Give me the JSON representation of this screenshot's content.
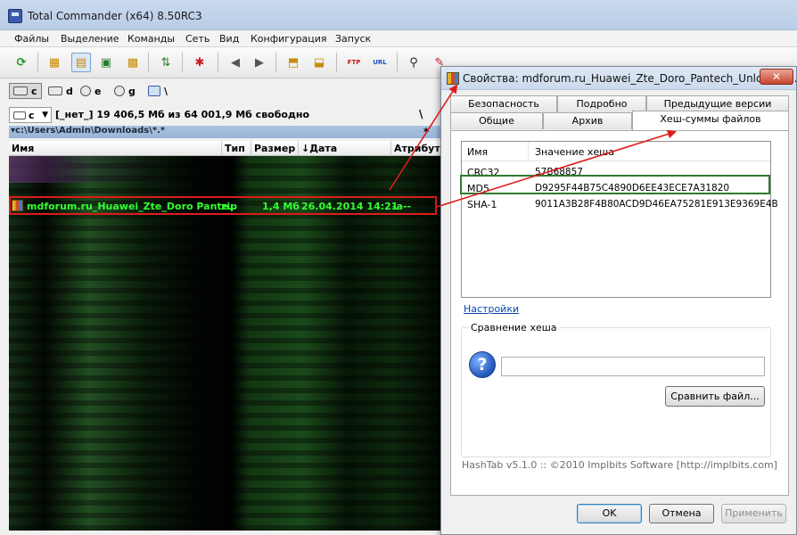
{
  "window": {
    "title": "Total Commander (x64) 8.50RC3",
    "menu": [
      "Файлы",
      "Выделение",
      "Команды",
      "Сеть",
      "Вид",
      "Конфигурация",
      "Запуск"
    ]
  },
  "toolbar": {
    "icons": [
      "refresh-icon",
      "brief-view-icon",
      "full-view-icon",
      "thumbnail-view-icon",
      "tree-view-icon",
      "invert-selection-icon",
      "edit-icon",
      "back-icon",
      "forward-icon",
      "pack-icon",
      "unpack-icon",
      "ftp-connect-icon",
      "url-connect-icon",
      "search-binoculars-icon",
      "multi-rename-icon",
      "sync-dirs-icon",
      "copy-names-icon",
      "notepad-icon"
    ],
    "ftp_label": "FTP",
    "url_label": "URL"
  },
  "drives": [
    "c",
    "d",
    "e",
    "g",
    "\\"
  ],
  "panel": {
    "drive_combo": "c",
    "free_space": "[_нет_]  19 406,5 Мб из 64 001,9 Мб свободно",
    "root_button": "\\",
    "path": "▾c:\\Users\\Admin\\Downloads\\*.*",
    "path_star": "*",
    "columns": [
      "Имя",
      "Тип",
      "Размер",
      "↓Дата",
      "Атрибут"
    ],
    "selected_file": {
      "name": "mdforum.ru_Huawei_Zte_Doro Pante..",
      "type": "zip",
      "size": "1,4 Мб",
      "date": "26.04.2014 14:21",
      "attr": "-a--"
    }
  },
  "dialog": {
    "title": "Свойства: mdforum.ru_Huawei_Zte_Doro_Pantech_Unlocker_...",
    "close_label": "✕",
    "tabs_back": [
      "Безопасность",
      "Подробно",
      "Предыдущие версии"
    ],
    "tabs_front": [
      "Общие",
      "Архив",
      "Хеш-суммы файлов"
    ],
    "hash_list": {
      "col_name": "Имя",
      "col_value": "Значение хеша",
      "rows": [
        {
          "alg": "CRC32",
          "value": "57B68857"
        },
        {
          "alg": "MD5",
          "value": "D9295F44B75C4890D6EE43ECE7A31820"
        },
        {
          "alg": "SHA-1",
          "value": "9011A3B28F4B80ACD9D46EA75281E913E9369E4B"
        }
      ]
    },
    "settings_link": "Настройки",
    "compare_legend": "Сравнение хеша",
    "compare_input_value": "",
    "compare_button": "Сравнить файл...",
    "copyright": "HashTab v5.1.0 :: ©2010 Implbits Software [http://implbits.com]",
    "buttons": {
      "ok": "OK",
      "cancel": "Отмена",
      "apply": "Применить"
    }
  },
  "colors": {
    "selected_file_text": "#33ff33",
    "annotation_red": "#e01b1b",
    "md5_highlight": "#2f7a2f"
  }
}
